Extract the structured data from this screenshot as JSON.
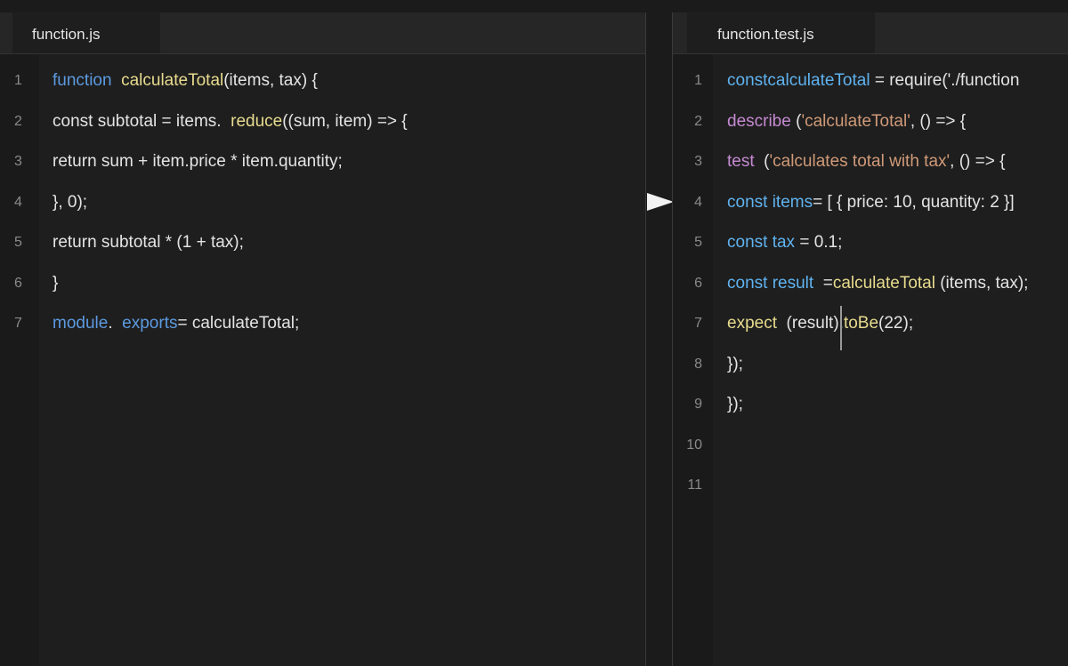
{
  "left_editor": {
    "tab_label": "function.js",
    "lines": [
      {
        "num": "1",
        "parts": [
          {
            "t": "function",
            "c": "kw"
          },
          {
            "t": "  ",
            "c": "tx"
          },
          {
            "t": "calculateTotal",
            "c": "fn"
          },
          {
            "t": "(items, tax) {",
            "c": "tx"
          }
        ]
      },
      {
        "num": "2",
        "parts": [
          {
            "t": "const subtotal = items.  ",
            "c": "tx"
          },
          {
            "t": "reduce",
            "c": "fn"
          },
          {
            "t": "((sum, item) => {",
            "c": "tx"
          }
        ]
      },
      {
        "num": "3",
        "parts": [
          {
            "t": "return sum + item.price * item.quantity;",
            "c": "tx"
          }
        ]
      },
      {
        "num": "4",
        "parts": [
          {
            "t": "}, 0);",
            "c": "tx"
          }
        ]
      },
      {
        "num": "5",
        "parts": [
          {
            "t": "return subtotal * (1 + tax);",
            "c": "tx"
          }
        ]
      },
      {
        "num": "6",
        "parts": [
          {
            "t": "}",
            "c": "tx"
          }
        ]
      },
      {
        "num": "7",
        "parts": [
          {
            "t": "module",
            "c": "kw"
          },
          {
            "t": ".  ",
            "c": "tx"
          },
          {
            "t": "exports",
            "c": "kw"
          },
          {
            "t": "= calculateTotal;",
            "c": "tx"
          }
        ]
      }
    ]
  },
  "right_editor": {
    "tab_label": "function.test.js",
    "lines": [
      {
        "num": "1",
        "parts": [
          {
            "t": "const",
            "c": "kw2"
          },
          {
            "t": "calculateTotal",
            "c": "kw2"
          },
          {
            "t": " = require('./function",
            "c": "tx"
          }
        ]
      },
      {
        "num": "2",
        "parts": [
          {
            "t": "describe",
            "c": "pk"
          },
          {
            "t": " (",
            "c": "tx"
          },
          {
            "t": "'calculateTotal'",
            "c": "str"
          },
          {
            "t": ", () => {",
            "c": "tx"
          }
        ]
      },
      {
        "num": "3",
        "parts": [
          {
            "t": "test",
            "c": "pk"
          },
          {
            "t": "  (",
            "c": "tx"
          },
          {
            "t": "'calculates total with tax'",
            "c": "str"
          },
          {
            "t": ", () => {",
            "c": "tx"
          }
        ]
      },
      {
        "num": "4",
        "parts": [
          {
            "t": "const ",
            "c": "kw2"
          },
          {
            "t": "items",
            "c": "kw2"
          },
          {
            "t": "= [ { price: 10, quantity: 2 }]",
            "c": "tx"
          }
        ]
      },
      {
        "num": "5",
        "parts": [
          {
            "t": "const ",
            "c": "kw2"
          },
          {
            "t": "tax",
            "c": "kw2"
          },
          {
            "t": " = 0.1;",
            "c": "tx"
          }
        ]
      },
      {
        "num": "6",
        "parts": [
          {
            "t": "const ",
            "c": "kw2"
          },
          {
            "t": "result",
            "c": "kw2"
          },
          {
            "t": "  =",
            "c": "tx"
          },
          {
            "t": "calculateTotal",
            "c": "fn"
          },
          {
            "t": " (items, tax);",
            "c": "tx"
          }
        ]
      },
      {
        "num": "7",
        "parts": [
          {
            "t": "expect",
            "c": "fn"
          },
          {
            "t": "  (result).",
            "c": "tx"
          },
          {
            "t": "toBe",
            "c": "fn"
          },
          {
            "t": "(22);",
            "c": "tx"
          }
        ]
      },
      {
        "num": "8",
        "parts": [
          {
            "t": "});",
            "c": "tx"
          }
        ]
      },
      {
        "num": "9",
        "parts": [
          {
            "t": "});",
            "c": "tx"
          }
        ]
      },
      {
        "num": "10",
        "parts": []
      },
      {
        "num": "11",
        "parts": []
      }
    ]
  },
  "colors": {
    "keyword": "#5c9ae0",
    "identifier": "#5fb3f0",
    "function": "#e7db8e",
    "test_keyword": "#c68ad2",
    "string": "#d09a78",
    "text": "#e4e4e4",
    "background": "#1e1e1e"
  }
}
